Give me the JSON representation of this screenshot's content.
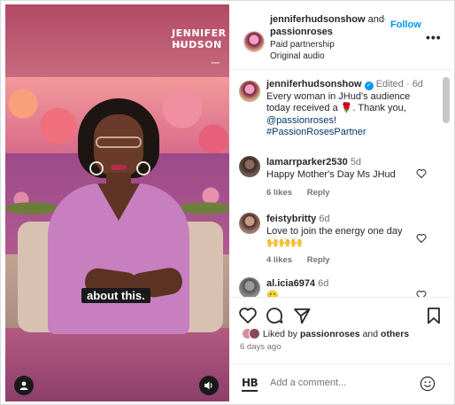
{
  "media": {
    "logo": {
      "line1": "JENNIFER",
      "line2": "HUDSON",
      "script": "the",
      "small": "show"
    },
    "caption": "about this.",
    "user_icon": "user-icon",
    "sound_icon": "speaker-icon"
  },
  "header": {
    "user1": "jenniferhudsonshow",
    "and": "and",
    "user2": "passionroses",
    "dot": "·",
    "follow": "Follow",
    "paid": "Paid partnership",
    "audio": "Original audio",
    "more": "•••"
  },
  "caption_comment": {
    "user": "jenniferhudsonshow",
    "edited": "Edited",
    "dot": "·",
    "time": "6d",
    "line1": "Every woman in JHud's audience",
    "line2_pre": "today received a",
    "rose": "🌹",
    "line2_post": ". Thank you,",
    "mention": "@passionroses",
    "mention_post": "!",
    "hashtag": "#PassionRosesPartner"
  },
  "comments": [
    {
      "user": "lamarrparker2530",
      "time": "5d",
      "text": "Happy Mother's Day Ms JHud",
      "likes": "6 likes",
      "reply": "Reply"
    },
    {
      "user": "feistybritty",
      "time": "6d",
      "text": "Love to join the energy one day",
      "emoji": "🙌🙌🙌",
      "likes": "4 likes",
      "reply": "Reply"
    },
    {
      "user": "al.icia6974",
      "time": "6d",
      "text": "🥲"
    }
  ],
  "likes": {
    "prefix": "Liked by",
    "user": "passionroses",
    "and": "and",
    "others": "others"
  },
  "posted": "6 days ago",
  "composer": {
    "logo": "HB",
    "placeholder": "Add a comment..."
  },
  "colors": {
    "accent": "#0095f6",
    "link": "#00376b",
    "muted": "#737373"
  }
}
